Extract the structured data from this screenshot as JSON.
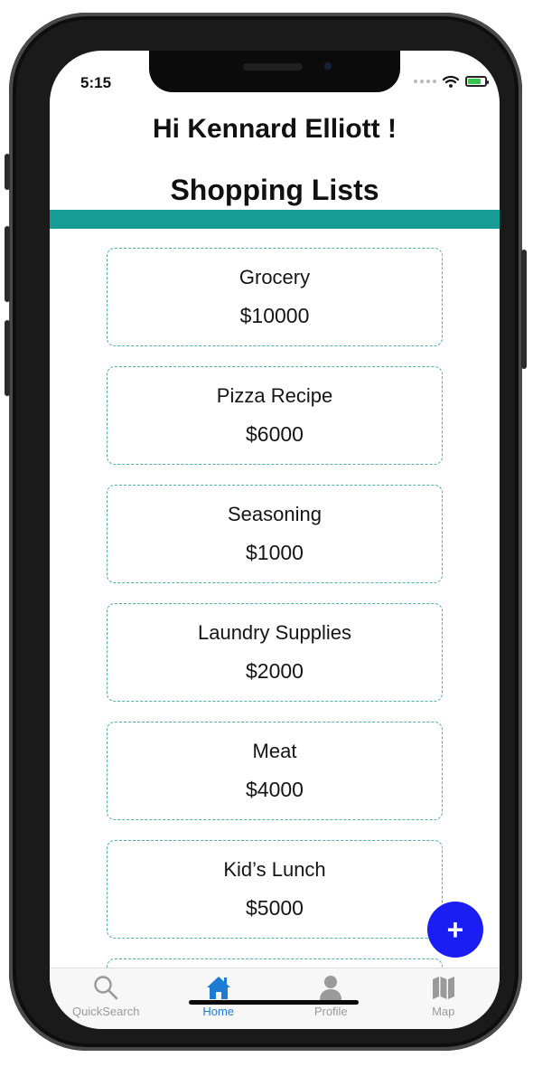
{
  "status_bar": {
    "time": "5:15"
  },
  "header": {
    "greeting": "Hi Kennard Elliott !",
    "title": "Shopping Lists"
  },
  "lists": [
    {
      "name": "Grocery",
      "price": "$10000"
    },
    {
      "name": "Pizza Recipe",
      "price": "$6000"
    },
    {
      "name": "Seasoning",
      "price": "$1000"
    },
    {
      "name": "Laundry Supplies",
      "price": "$2000"
    },
    {
      "name": "Meat",
      "price": "$4000"
    },
    {
      "name": "Kid’s Lunch",
      "price": "$5000"
    }
  ],
  "fab": {
    "label": "+",
    "icon": "plus-icon"
  },
  "tabs": [
    {
      "label": "QuickSearch",
      "icon": "search-icon"
    },
    {
      "label": "Home",
      "icon": "home-icon",
      "active": true
    },
    {
      "label": "Profile",
      "icon": "person-icon"
    },
    {
      "label": "Map",
      "icon": "map-icon"
    }
  ],
  "colors": {
    "accent": "#169c94",
    "fab": "#1b1ef2",
    "active_tab": "#1d7bd4",
    "inactive_tab": "#9a9a9a"
  }
}
